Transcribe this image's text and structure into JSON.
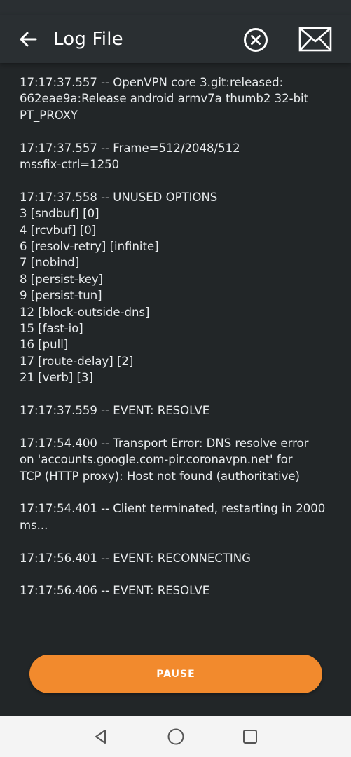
{
  "header": {
    "title": "Log File"
  },
  "icons": {
    "back": "arrow-left-icon",
    "clear": "close-circle-icon",
    "email": "envelope-icon"
  },
  "log": {
    "entries": [
      "17:17:37.557 -- OpenVPN core 3.git:released:\n662eae9a:Release android armv7a thumb2 32-bit\nPT_PROXY",
      "17:17:37.557 -- Frame=512/2048/512\nmssfix-ctrl=1250",
      "17:17:37.558 -- UNUSED OPTIONS\n3 [sndbuf] [0]\n4 [rcvbuf] [0]\n6 [resolv-retry] [infinite]\n7 [nobind]\n8 [persist-key]\n9 [persist-tun]\n12 [block-outside-dns]\n15 [fast-io]\n16 [pull]\n17 [route-delay] [2]\n21 [verb] [3]",
      "17:17:37.559 -- EVENT: RESOLVE",
      "17:17:54.400 -- Transport Error: DNS resolve error\non 'accounts.google.com-pir.coronavpn.net' for\nTCP (HTTP proxy): Host not found (authoritative)",
      "17:17:54.401 -- Client terminated, restarting in 2000\nms...",
      "17:17:56.401 -- EVENT: RECONNECTING",
      "17:17:56.406 -- EVENT: RESOLVE"
    ]
  },
  "footer": {
    "pause_label": "PAUSE"
  },
  "colors": {
    "background": "#222628",
    "app_bar": "#2a2f32",
    "accent": "#f28a2d",
    "text": "#e9ecee",
    "nav_bar": "#f4f4f4"
  }
}
